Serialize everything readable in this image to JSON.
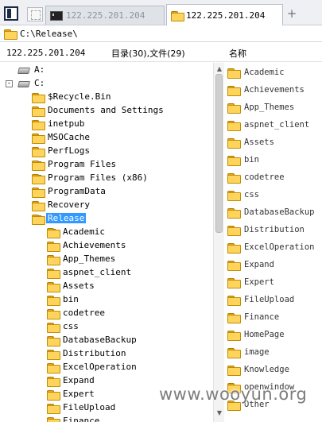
{
  "tabs": [
    {
      "label": "122.225.201.204",
      "active": false,
      "icon": "terminal-icon"
    },
    {
      "label": "122.225.201.204",
      "active": true,
      "icon": "folder-icon"
    }
  ],
  "address": {
    "value": "C:\\Release\\"
  },
  "header": {
    "host": "122.225.201.204",
    "counts": "目录(30),文件(29)",
    "name_column": "名称"
  },
  "tree": {
    "items": [
      {
        "label": "A:",
        "level": 0,
        "expander": "",
        "icon": "drive-icon"
      },
      {
        "label": "C:",
        "level": 0,
        "expander": "−",
        "icon": "drive-icon"
      },
      {
        "label": "$Recycle.Bin",
        "level": 1,
        "expander": "",
        "icon": "folder-icon"
      },
      {
        "label": "Documents and Settings",
        "level": 1,
        "expander": "",
        "icon": "folder-icon"
      },
      {
        "label": "inetpub",
        "level": 1,
        "expander": "",
        "icon": "folder-icon"
      },
      {
        "label": "MSOCache",
        "level": 1,
        "expander": "",
        "icon": "folder-icon"
      },
      {
        "label": "PerfLogs",
        "level": 1,
        "expander": "",
        "icon": "folder-icon"
      },
      {
        "label": "Program Files",
        "level": 1,
        "expander": "+",
        "icon": "folder-icon"
      },
      {
        "label": "Program Files (x86)",
        "level": 1,
        "expander": "+",
        "icon": "folder-icon"
      },
      {
        "label": "ProgramData",
        "level": 1,
        "expander": "",
        "icon": "folder-icon"
      },
      {
        "label": "Recovery",
        "level": 1,
        "expander": "",
        "icon": "folder-icon"
      },
      {
        "label": "Release",
        "level": 1,
        "expander": "−",
        "icon": "folder-icon",
        "selected": true
      },
      {
        "label": "Academic",
        "level": 2,
        "expander": "+",
        "icon": "folder-icon"
      },
      {
        "label": "Achievements",
        "level": 2,
        "expander": "",
        "icon": "folder-icon"
      },
      {
        "label": "App_Themes",
        "level": 2,
        "expander": "",
        "icon": "folder-icon"
      },
      {
        "label": "aspnet_client",
        "level": 2,
        "expander": "",
        "icon": "folder-icon"
      },
      {
        "label": "Assets",
        "level": 2,
        "expander": "",
        "icon": "folder-icon"
      },
      {
        "label": "bin",
        "level": 2,
        "expander": "",
        "icon": "folder-icon"
      },
      {
        "label": "codetree",
        "level": 2,
        "expander": "",
        "icon": "folder-icon"
      },
      {
        "label": "css",
        "level": 2,
        "expander": "",
        "icon": "folder-icon"
      },
      {
        "label": "DatabaseBackup",
        "level": 2,
        "expander": "",
        "icon": "folder-icon"
      },
      {
        "label": "Distribution",
        "level": 2,
        "expander": "",
        "icon": "folder-icon"
      },
      {
        "label": "ExcelOperation",
        "level": 2,
        "expander": "",
        "icon": "folder-icon"
      },
      {
        "label": "Expand",
        "level": 2,
        "expander": "",
        "icon": "folder-icon"
      },
      {
        "label": "Expert",
        "level": 2,
        "expander": "",
        "icon": "folder-icon"
      },
      {
        "label": "FileUpload",
        "level": 2,
        "expander": "",
        "icon": "folder-icon"
      },
      {
        "label": "Finance",
        "level": 2,
        "expander": "",
        "icon": "folder-icon"
      }
    ]
  },
  "list": {
    "items": [
      "Academic",
      "Achievements",
      "App_Themes",
      "aspnet_client",
      "Assets",
      "bin",
      "codetree",
      "css",
      "DatabaseBackup",
      "Distribution",
      "ExcelOperation",
      "Expand",
      "Expert",
      "FileUpload",
      "Finance",
      "HomePage",
      "image",
      "Knowledge",
      "openwindow",
      "Other"
    ]
  },
  "watermark": "www.wooyun.org",
  "colors": {
    "selection": "#3399ff",
    "folder": "#ffd45c",
    "tabbar": "#eef0f3"
  }
}
